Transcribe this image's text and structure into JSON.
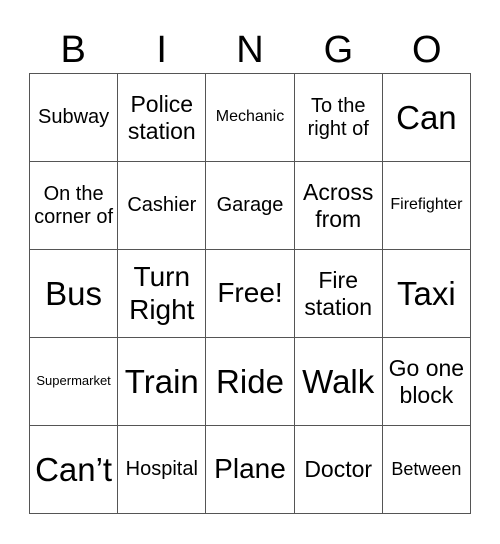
{
  "header": [
    "B",
    "I",
    "N",
    "G",
    "O"
  ],
  "cells": [
    [
      "Subway",
      "Police station",
      "Mechanic",
      "To the right of",
      "Can"
    ],
    [
      "On the corner of",
      "Cashier",
      "Garage",
      "Across from",
      "Firefighter"
    ],
    [
      "Bus",
      "Turn Right",
      "Free!",
      "Fire station",
      "Taxi"
    ],
    [
      "Supermarket",
      "Train",
      "Ride",
      "Walk",
      "Go one block"
    ],
    [
      "Can’t",
      "Hospital",
      "Plane",
      "Doctor",
      "Between"
    ]
  ]
}
